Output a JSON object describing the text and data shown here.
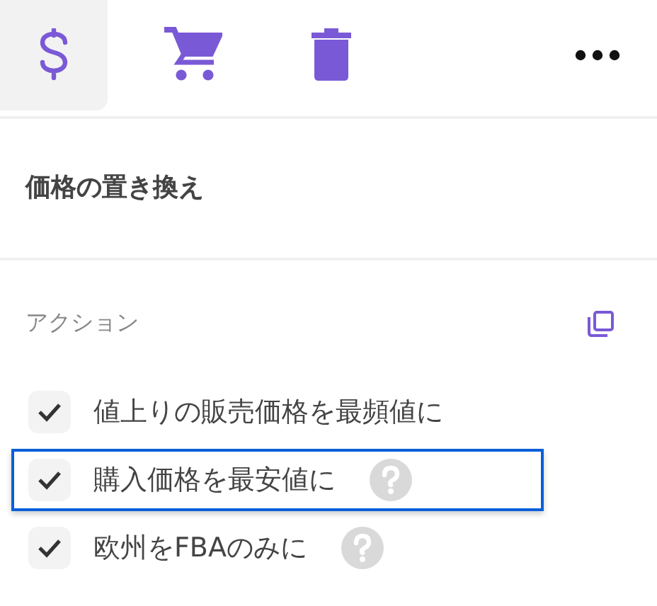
{
  "toolbar": {
    "tabs": [
      {
        "kind": "dollar",
        "selected": true
      },
      {
        "kind": "cart",
        "selected": false
      },
      {
        "kind": "trash",
        "selected": false
      }
    ]
  },
  "title": "価格の置き換え",
  "section": {
    "label": "アクション"
  },
  "actions": [
    {
      "label": "値上りの販売価格を最頻値に",
      "checked": true,
      "selected": false,
      "help": false
    },
    {
      "label": "購入価格を最安値に",
      "checked": true,
      "selected": true,
      "help": true
    },
    {
      "label": "欧州をFBAのみに",
      "checked": true,
      "selected": false,
      "help": true
    }
  ]
}
